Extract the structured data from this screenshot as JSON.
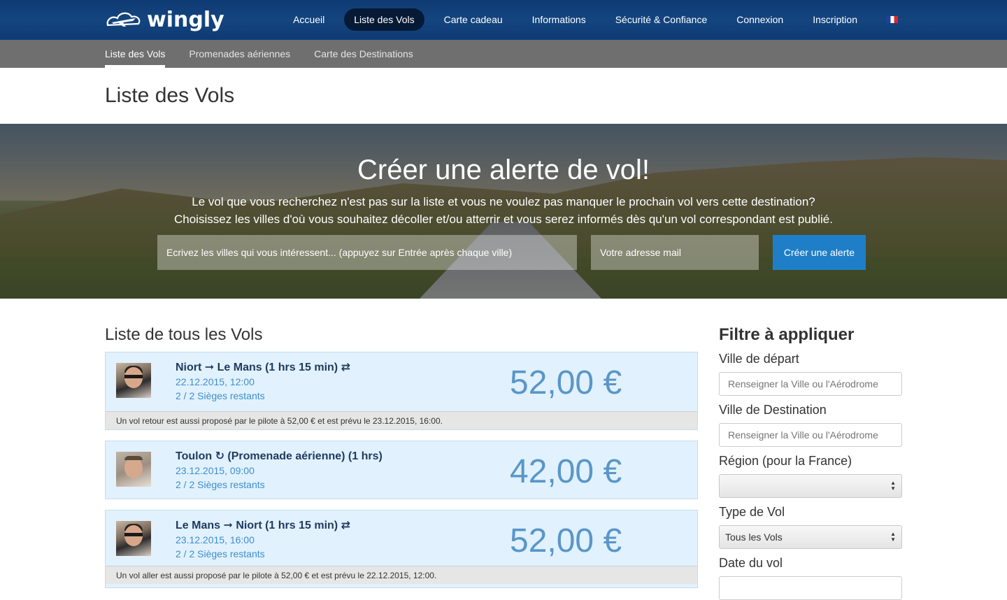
{
  "brand": {
    "name": "wingly"
  },
  "nav": {
    "items": [
      {
        "label": "Accueil"
      },
      {
        "label": "Liste des Vols",
        "active": true
      },
      {
        "label": "Carte cadeau"
      },
      {
        "label": "Informations"
      },
      {
        "label": "Sécurité & Confiance"
      },
      {
        "label": "Connexion"
      },
      {
        "label": "Inscription"
      }
    ],
    "language_icon": "flag-fr-icon"
  },
  "subnav": {
    "items": [
      {
        "label": "Liste des Vols",
        "active": true
      },
      {
        "label": "Promenades aériennes"
      },
      {
        "label": "Carte des Destinations"
      }
    ]
  },
  "page_title": "Liste des Vols",
  "hero": {
    "title": "Créer une alerte de vol!",
    "line1": "Le vol que vous recherchez n'est pas sur la liste et vous ne voulez pas manquer le prochain vol vers cette destination?",
    "line2": "Choisissez les villes d'où vous souhaitez décoller et/ou atterrir et vous serez informés dès qu'un vol correspondant est publié.",
    "cities_placeholder": "Ecrivez les villes qui vous intéressent... (appuyez sur Entrée après chaque ville)",
    "email_placeholder": "Votre adresse mail",
    "button_label": "Créer une alerte"
  },
  "list_title": "Liste de tous les Vols",
  "flights": [
    {
      "route": "Niort ➞ Le Mans (1 hrs 15 min) ⇄",
      "date": "22.12.2015, 12:00",
      "seats": "2 / 2 Sièges restants",
      "price": "52,00 €",
      "note": "Un vol retour est aussi proposé par le pilote à 52,00 € et est prévu le 23.12.2015, 16:00."
    },
    {
      "route": "Toulon ↻ (Promenade aérienne) (1 hrs)",
      "date": "23.12.2015, 09:00",
      "seats": "2 / 2 Sièges restants",
      "price": "42,00 €",
      "note": ""
    },
    {
      "route": "Le Mans ➞ Niort (1 hrs 15 min) ⇄",
      "date": "23.12.2015, 16:00",
      "seats": "2 / 2 Sièges restants",
      "price": "52,00 €",
      "note": "Un vol aller est aussi proposé par le pilote à 52,00 € et est prévu le 22.12.2015, 12:00."
    }
  ],
  "filter": {
    "title": "Filtre à appliquer",
    "departure_label": "Ville de départ",
    "departure_placeholder": "Renseigner la Ville ou l'Aérodrome",
    "destination_label": "Ville de Destination",
    "destination_placeholder": "Renseigner la Ville ou l'Aérodrome",
    "region_label": "Région (pour la France)",
    "region_value": "",
    "type_label": "Type de Vol",
    "type_value": "Tous les Vols",
    "date_label": "Date du vol"
  },
  "colors": {
    "nav_bg": "#14457f",
    "subnav_bg": "#6f6f6f",
    "accent": "#1e7fc8",
    "card_bg": "#e1f1fd",
    "price": "#5a96c8"
  }
}
